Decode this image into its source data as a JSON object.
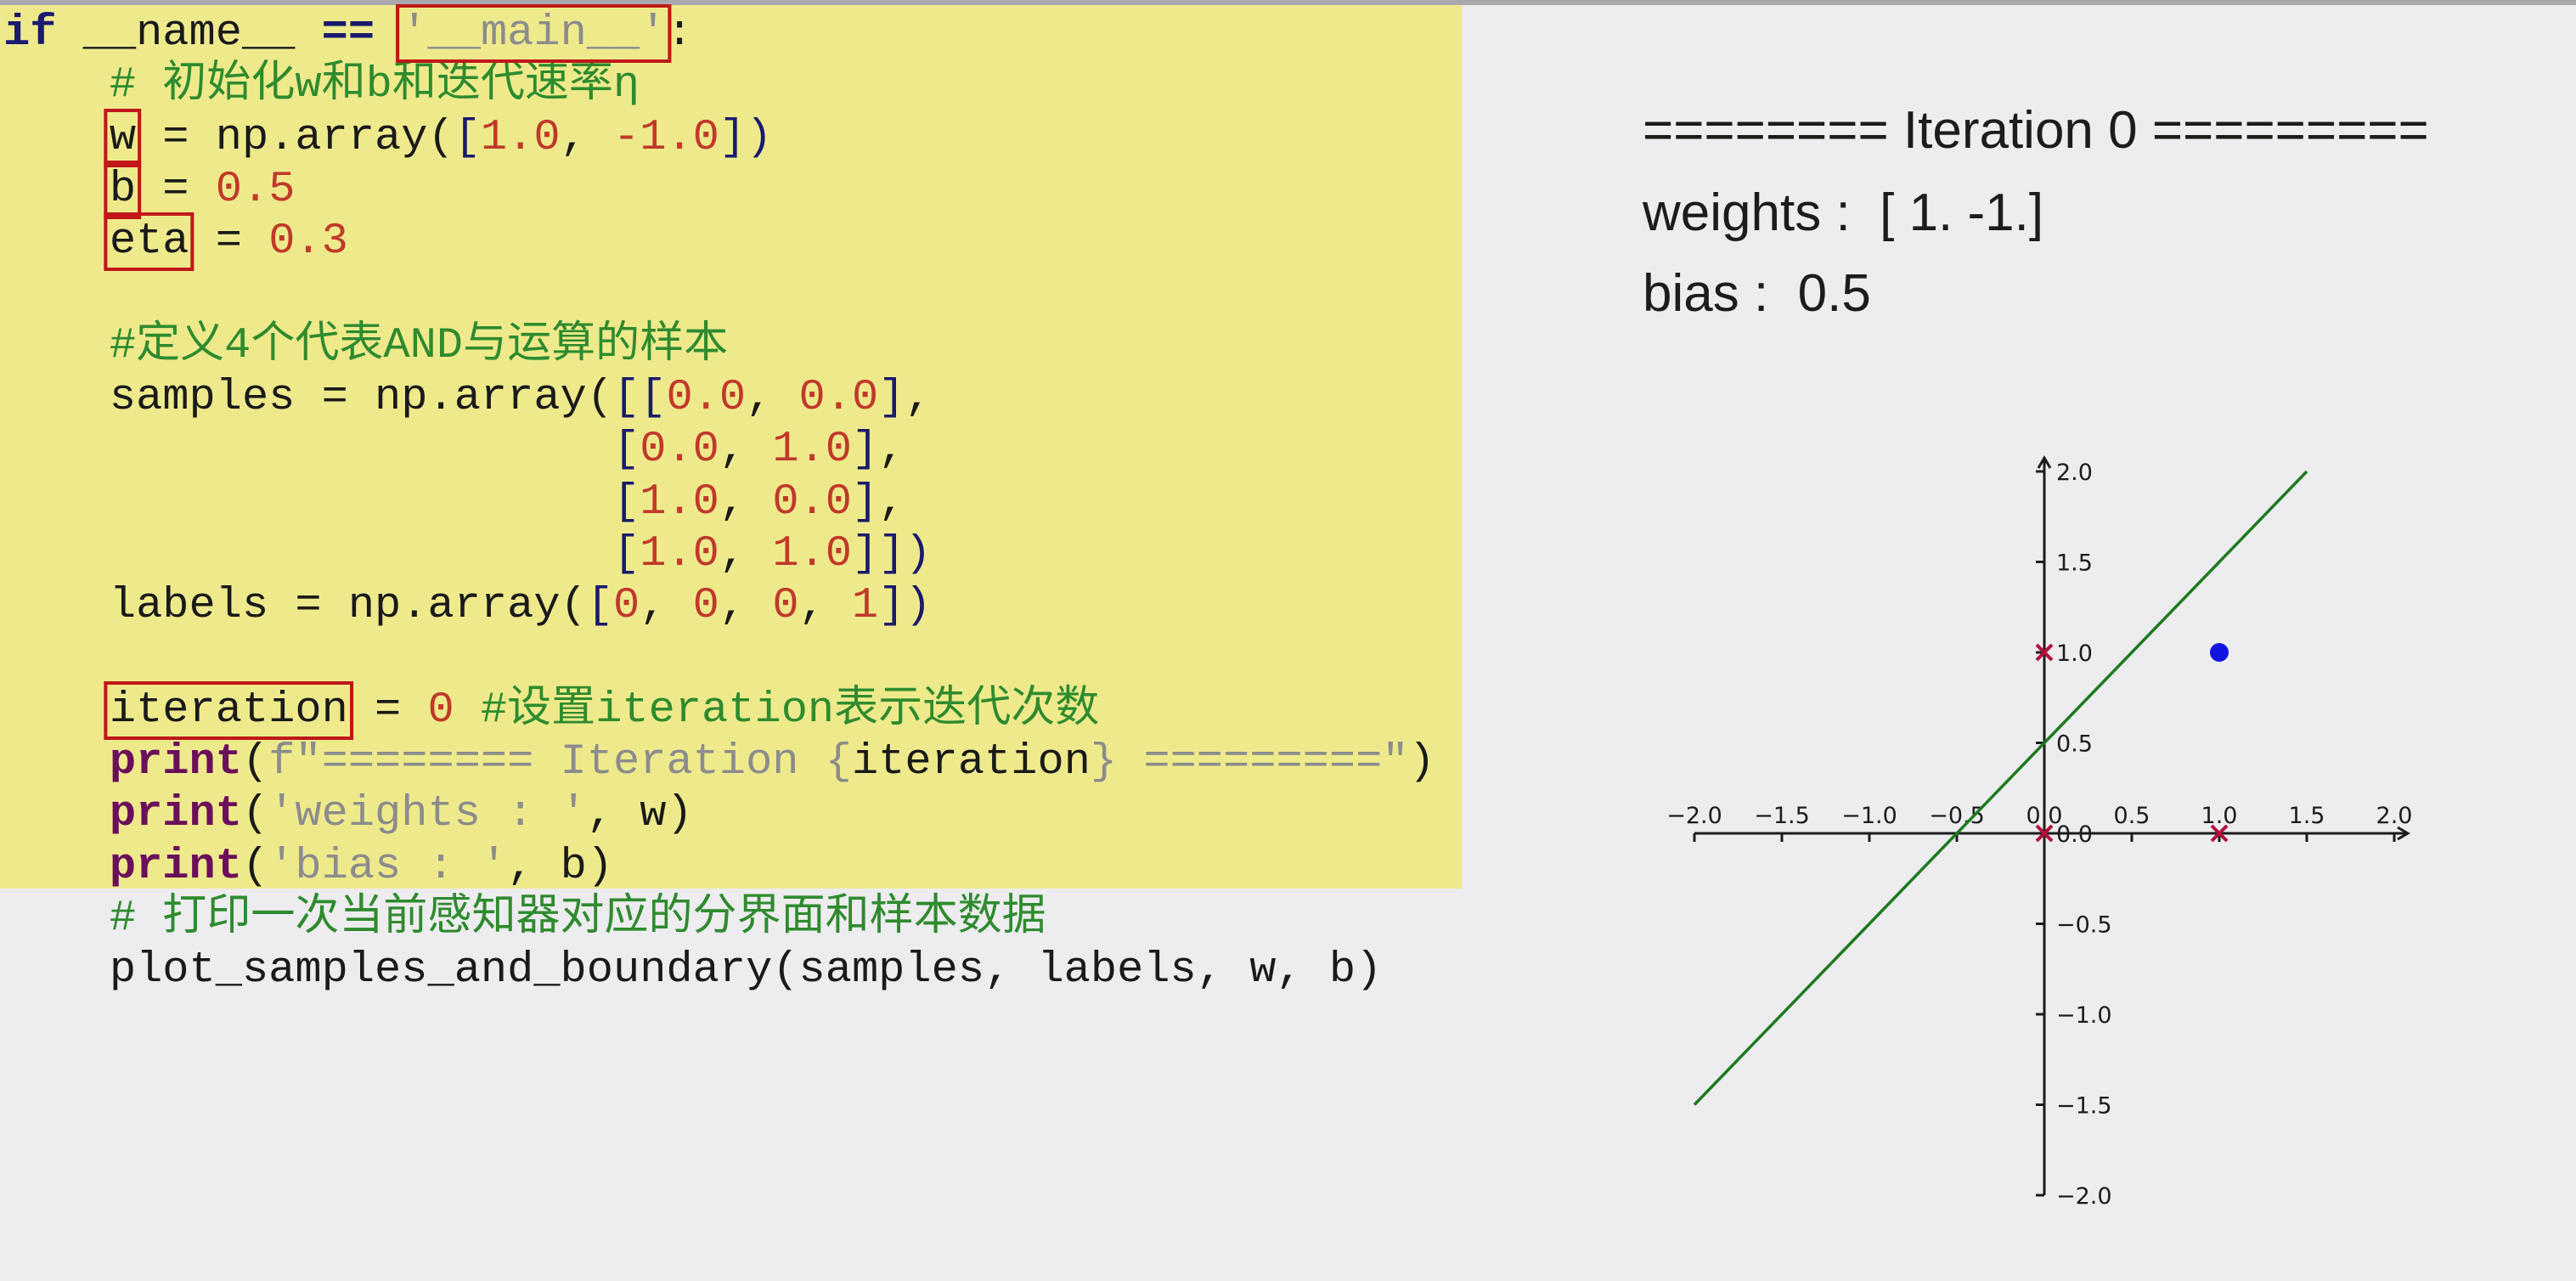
{
  "code": {
    "lines": [
      [
        [
          "if",
          "kw"
        ],
        [
          " __name__ ",
          ""
        ],
        [
          "==",
          "kw"
        ],
        [
          " ",
          ""
        ],
        [
          "'__main__'",
          "str box"
        ],
        [
          ":",
          ""
        ]
      ],
      [
        [
          "    ",
          ""
        ],
        [
          "# 初始化w和b和迭代速率η",
          "cm"
        ]
      ],
      [
        [
          "    ",
          ""
        ],
        [
          "w",
          "box"
        ],
        [
          " = np.array(",
          ""
        ],
        [
          "[",
          "br"
        ],
        [
          "1.0",
          "num"
        ],
        [
          ", ",
          ""
        ],
        [
          "-1.0",
          "num"
        ],
        [
          "])",
          "br"
        ]
      ],
      [
        [
          "    ",
          ""
        ],
        [
          "b",
          "box"
        ],
        [
          " = ",
          ""
        ],
        [
          "0.5",
          "num"
        ]
      ],
      [
        [
          "    ",
          ""
        ],
        [
          "eta",
          "box"
        ],
        [
          " = ",
          ""
        ],
        [
          "0.3",
          "num"
        ]
      ],
      [],
      [
        [
          "    ",
          ""
        ],
        [
          "#定义4个代表AND与运算的样本",
          "cm"
        ]
      ],
      [
        [
          "    samples = np.array(",
          ""
        ],
        [
          "[[",
          "br"
        ],
        [
          "0.0",
          "num"
        ],
        [
          ", ",
          ""
        ],
        [
          "0.0",
          "num"
        ],
        [
          "]",
          "br"
        ],
        [
          ",",
          ""
        ]
      ],
      [
        [
          "                       ",
          ""
        ],
        [
          "[",
          "br"
        ],
        [
          "0.0",
          "num"
        ],
        [
          ", ",
          ""
        ],
        [
          "1.0",
          "num"
        ],
        [
          "]",
          "br"
        ],
        [
          ",",
          ""
        ]
      ],
      [
        [
          "                       ",
          ""
        ],
        [
          "[",
          "br"
        ],
        [
          "1.0",
          "num"
        ],
        [
          ", ",
          ""
        ],
        [
          "0.0",
          "num"
        ],
        [
          "]",
          "br"
        ],
        [
          ",",
          ""
        ]
      ],
      [
        [
          "                       ",
          ""
        ],
        [
          "[",
          "br"
        ],
        [
          "1.0",
          "num"
        ],
        [
          ", ",
          ""
        ],
        [
          "1.0",
          "num"
        ],
        [
          "]])",
          "br"
        ]
      ],
      [
        [
          "    labels = np.array(",
          ""
        ],
        [
          "[",
          "br"
        ],
        [
          "0",
          "num"
        ],
        [
          ", ",
          ""
        ],
        [
          "0",
          "num"
        ],
        [
          ", ",
          ""
        ],
        [
          "0",
          "num"
        ],
        [
          ", ",
          ""
        ],
        [
          "1",
          "num"
        ],
        [
          "])",
          "br"
        ]
      ],
      [],
      [
        [
          "    ",
          ""
        ],
        [
          "iteration",
          "box"
        ],
        [
          " = ",
          ""
        ],
        [
          "0",
          "num"
        ],
        [
          " #设置iteration表示迭代次数",
          "cm"
        ]
      ],
      [
        [
          "    ",
          ""
        ],
        [
          "print",
          "fn"
        ],
        [
          "(",
          ""
        ],
        [
          "f\"======== Iteration {",
          "str"
        ],
        [
          "iteration",
          ""
        ],
        [
          "} =========\"",
          "str"
        ],
        [
          ")",
          ""
        ]
      ],
      [
        [
          "    ",
          ""
        ],
        [
          "print",
          "fn"
        ],
        [
          "(",
          ""
        ],
        [
          "'weights : '",
          "str"
        ],
        [
          ", w)",
          ""
        ]
      ],
      [
        [
          "    ",
          ""
        ],
        [
          "print",
          "fn"
        ],
        [
          "(",
          ""
        ],
        [
          "'bias : '",
          "str"
        ],
        [
          ", b)",
          ""
        ]
      ],
      [
        [
          "    ",
          ""
        ],
        [
          "# 打印一次当前感知器对应的分界面和样本数据",
          "cm"
        ]
      ],
      [
        [
          "    plot_samples_and_boundary(samples, labels, w, b)",
          ""
        ]
      ]
    ]
  },
  "output": {
    "iteration_line": "======== Iteration 0 =========",
    "weights_line": "weights :  [ 1. -1.]",
    "bias_line": "bias :  0.5"
  },
  "chart_data": {
    "type": "scatter",
    "xlim": [
      -2.0,
      2.0
    ],
    "ylim": [
      -2.0,
      2.0
    ],
    "xticks": [
      "−2.0",
      "−1.5",
      "−1.0",
      "−0.5",
      "0.0",
      "0.5",
      "1.0",
      "1.5",
      "2.0"
    ],
    "yticks": [
      "−2.0",
      "−1.5",
      "−1.0",
      "−0.5",
      "0.0",
      "0.5",
      "1.0",
      "1.5",
      "2.0"
    ],
    "tick_values": [
      -2.0,
      -1.5,
      -1.0,
      -0.5,
      0.0,
      0.5,
      1.0,
      1.5,
      2.0
    ],
    "negative_points": [
      [
        0,
        0
      ],
      [
        0,
        1
      ],
      [
        1,
        0
      ]
    ],
    "positive_points": [
      [
        1,
        1
      ]
    ],
    "boundary": {
      "w": [
        1.0,
        -1.0
      ],
      "b": 0.5,
      "x_range": [
        -2.0,
        1.5
      ]
    },
    "colors": {
      "negative": "#b0103a",
      "positive": "#1414e0",
      "boundary": "#1d7a1d",
      "axis": "#1c1c1c"
    }
  }
}
